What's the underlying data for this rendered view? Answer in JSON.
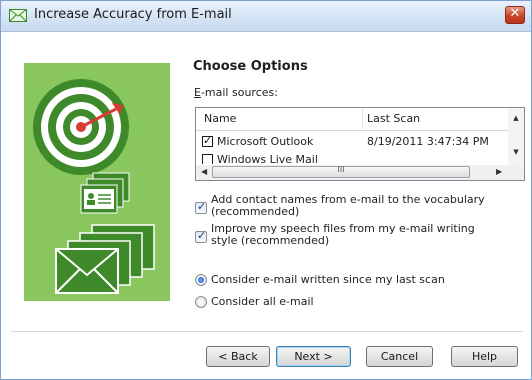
{
  "window": {
    "title": "Increase Accuracy from E-mail"
  },
  "main": {
    "heading": "Choose Options",
    "sources_label": "E-mail sources:"
  },
  "list": {
    "columns": [
      "Name",
      "Last Scan"
    ],
    "rows": [
      {
        "name": "Microsoft Outlook",
        "last_scan": "8/19/2011 3:47:34 PM",
        "checked": true
      },
      {
        "name": "Windows Live Mail",
        "last_scan": "",
        "checked": false
      }
    ],
    "hscroll_grip": "III"
  },
  "options": {
    "add_contacts": "Add contact names from e-mail to the vocabulary (recommended)",
    "improve_speech": "Improve my speech files from my e-mail writing style (recommended)",
    "radio_since_last": "Consider e-mail written since my last scan",
    "radio_all": "Consider all e-mail"
  },
  "buttons": {
    "back": "< Back",
    "next": "Next >",
    "cancel": "Cancel",
    "help": "Help"
  },
  "colors": {
    "illustration_green": "#89c65d",
    "dark_green": "#3e8a2a",
    "target_red": "#d63c2f",
    "close_red": "#c5432b"
  }
}
